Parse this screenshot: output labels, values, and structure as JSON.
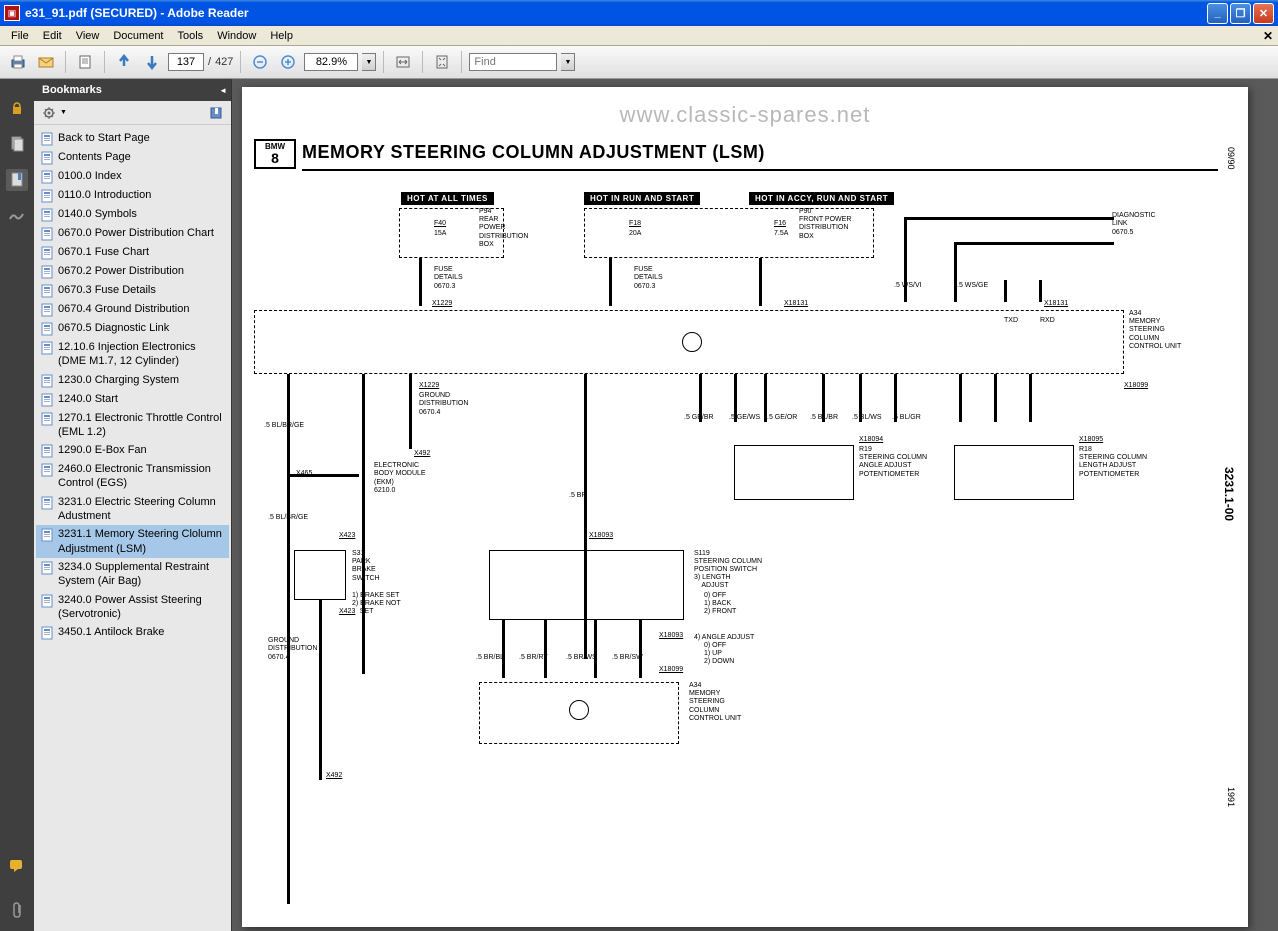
{
  "titlebar": {
    "text": "e31_91.pdf (SECURED) - Adobe Reader"
  },
  "menu": {
    "file": "File",
    "edit": "Edit",
    "view": "View",
    "document": "Document",
    "tools": "Tools",
    "window": "Window",
    "help": "Help"
  },
  "toolbar": {
    "page_current": "137",
    "page_sep": "/",
    "page_total": "427",
    "zoom": "82.9%",
    "find_placeholder": "Find"
  },
  "bookmarks": {
    "title": "Bookmarks",
    "items": [
      "Back to Start Page",
      "Contents Page",
      "0100.0 Index",
      "0110.0 Introduction",
      "0140.0 Symbols",
      "0670.0 Power Distribution Chart",
      "0670.1 Fuse Chart",
      "0670.2 Power Distribution",
      "0670.3 Fuse Details",
      "0670.4 Ground Distribution",
      "0670.5 Diagnostic Link",
      "12.10.6 Injection Electronics (DME M1.7, 12 Cylinder)",
      "1230.0 Charging System",
      "1240.0 Start",
      "1270.1 Electronic Throttle Control (EML 1.2)",
      "1290.0 E-Box Fan",
      "2460.0 Electronic Transmission Control (EGS)",
      "3231.0 Electric Steering Column Adustment",
      "3231.1 Memory Steering Clolumn Adjustment (LSM)",
      "3234.0 Supplemental Restraint System (Air Bag)",
      "3240.0 Power Assist Steering (Servotronic)",
      "3450.1 Antilock Brake"
    ],
    "selected_index": 18
  },
  "document": {
    "watermark": "www.classic-spares.net",
    "title": "MEMORY STEERING COLUMN ADJUSTMENT (LSM)",
    "bmw_top": "BMW",
    "bmw_bottom": "8",
    "date_top": "09/90",
    "circuit_id": "3231.1-00",
    "date_bottom": "1991"
  },
  "diagram": {
    "hot1": "HOT AT ALL TIMES",
    "hot2": "HOT IN RUN AND START",
    "hot3": "HOT IN ACCY, RUN AND START",
    "f40": "F40",
    "f40a": "15A",
    "p94": "P94",
    "p94t": "REAR\nPOWER\nDISTRIBUTION\nBOX",
    "f18": "F18",
    "f18a": "20A",
    "f16": "F16",
    "f16a": "7.5A",
    "p90": "P90",
    "p90t": "FRONT POWER\nDISTRIBUTION\nBOX",
    "diag": "DIAGNOSTIC\nLINK\n0670.5",
    "fuse_det": "FUSE\nDETAILS\n0670.3",
    "wsvi": ".5 WS/VI",
    "wsge": ".5 WS/GE",
    "txd": "TXD",
    "rxd": "RXD",
    "a34": "A34",
    "a34t": "MEMORY\nSTEERING\nCOLUMN\nCONTROL UNIT",
    "x1229": "X1229",
    "x18131": "X18131",
    "x18099": "X18099",
    "x465": "X465",
    "x423": "X423",
    "x492": "X492",
    "x18093": "X18093",
    "x18094": "X18094",
    "x18095": "X18095",
    "gnd_dist": "GROUND\nDISTRIBUTION\n0670.4",
    "ekm": "ELECTRONIC\nBODY MODULE\n(EKM)\n6210.0",
    "blbrge": ".5 BL/BR/GE",
    "gebr": ".5 GE/BR",
    "gews": ".5 GE/WS",
    "geor": ".5 GE/OR",
    "blbr": ".5 BL/BR",
    "blws": ".5 BL/WS",
    "blgr": ".5 BL/GR",
    "br5": ".5 BR",
    "r19": "R19",
    "r19t": "STEERING COLUMN\nANGLE ADJUST\nPOTENTIOMETER",
    "r18": "R18",
    "r18t": "STEERING COLUMN\nLENGTH ADJUST\nPOTENTIOMETER",
    "s31": "S31",
    "s31t": "PARK\nBRAKE\nSWITCH",
    "s31_1": "1) BRAKE SET",
    "s31_2": "2) BRAKE NOT\n    SET",
    "s119": "S119",
    "s119t": "STEERING COLUMN\nPOSITION SWITCH",
    "s119_3": "3) LENGTH\n    ADJUST",
    "s119_0a": "0) OFF",
    "s119_1a": "1) BACK",
    "s119_2a": "2) FRONT",
    "s119_4": "4) ANGLE ADJUST",
    "s119_0b": "0) OFF",
    "s119_1b": "1) UP",
    "s119_2b": "2) DOWN",
    "brbl": ".5 BR/BL",
    "brrt": ".5 BR/RT",
    "brws": ".5 BR/WS",
    "brsw": ".5 BR/SW"
  }
}
